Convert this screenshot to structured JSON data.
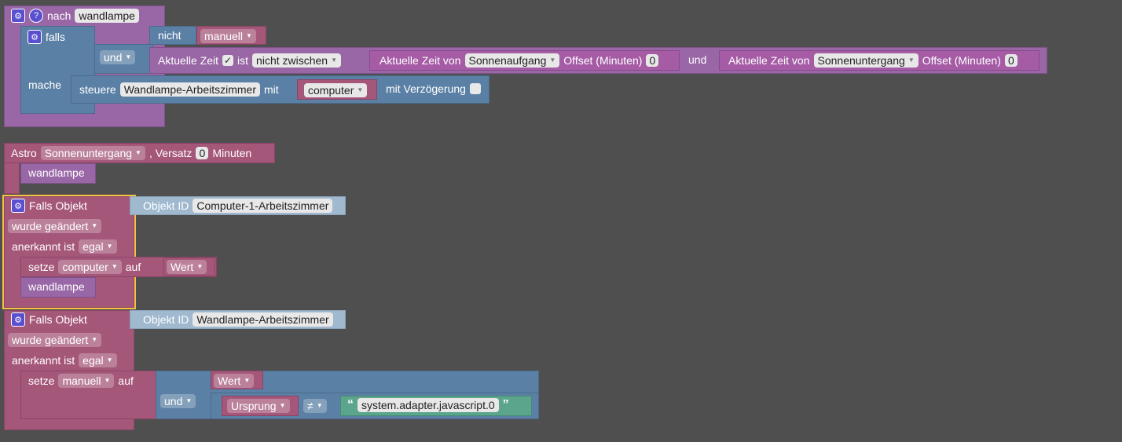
{
  "b1": {
    "nach": "nach",
    "nach_var": "wandlampe",
    "falls": "falls",
    "nicht": "nicht",
    "manuell": "manuell",
    "und": "und",
    "aktuelle_zeit": "Aktuelle Zeit",
    "ist": "ist",
    "nicht_zwischen": "nicht zwischen",
    "akt_von_1": "Aktuelle Zeit von",
    "sonnenaufgang": "Sonnenaufgang",
    "offset_1": "Offset (Minuten)",
    "offset_1_val": "0",
    "und2": "und",
    "akt_von_2": "Aktuelle Zeit von",
    "sonnenuntergang": "Sonnenuntergang",
    "offset_2": "Offset (Minuten)",
    "offset_2_val": "0",
    "mache": "mache",
    "steuere": "steuere",
    "device": "Wandlampe-Arbeitszimmer",
    "mit": "mit",
    "computer": "computer",
    "mit_verz": "mit Verzögerung"
  },
  "b2": {
    "astro": "Astro",
    "sonnenuntergang": "Sonnenuntergang",
    "versatz": ", Versatz",
    "versatz_val": "0",
    "minuten": "Minuten",
    "call": "wandlampe"
  },
  "b3": {
    "falls_objekt": "Falls Objekt",
    "objekt_id": "Objekt ID",
    "objekt_id_val": "Computer-1-Arbeitszimmer",
    "wurde": "wurde geändert",
    "anerkannt": "anerkannt ist",
    "egal": "egal",
    "setze": "setze",
    "computer": "computer",
    "auf": "auf",
    "wert": "Wert",
    "call": "wandlampe"
  },
  "b4": {
    "falls_objekt": "Falls Objekt",
    "objekt_id": "Objekt ID",
    "objekt_id_val": "Wandlampe-Arbeitszimmer",
    "wurde": "wurde geändert",
    "anerkannt": "anerkannt ist",
    "egal": "egal",
    "setze": "setze",
    "manuell": "manuell",
    "auf": "auf",
    "wert": "Wert",
    "und": "und",
    "ursprung": "Ursprung",
    "neq": "≠",
    "string": "system.adapter.javascript.0"
  }
}
